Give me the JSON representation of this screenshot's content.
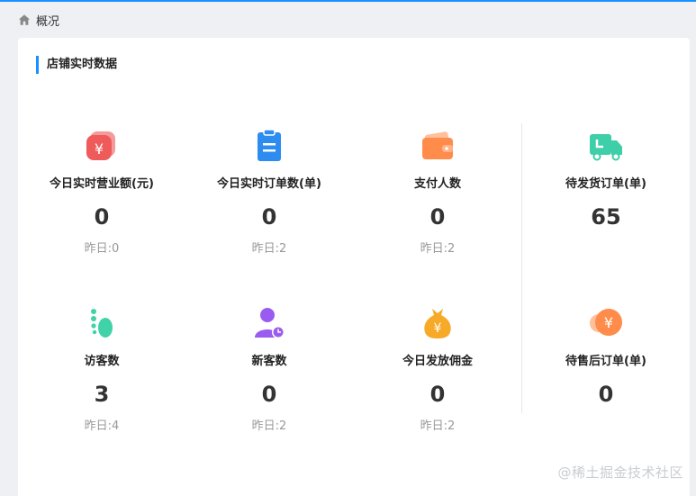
{
  "breadcrumb": {
    "label": "概况"
  },
  "section": {
    "title": "店铺实时数据"
  },
  "stats_row1": [
    {
      "label": "今日实时营业额(元)",
      "value": "0",
      "sub": "昨日:0",
      "icon": "money-card-icon",
      "color": "#ef5a5a"
    },
    {
      "label": "今日实时订单数(单)",
      "value": "0",
      "sub": "昨日:2",
      "icon": "clipboard-icon",
      "color": "#2d8cf0"
    },
    {
      "label": "支付人数",
      "value": "0",
      "sub": "昨日:2",
      "icon": "wallet-icon",
      "color": "#ff8c4a"
    },
    {
      "label": "待发货订单(单)",
      "value": "65",
      "sub": "",
      "icon": "truck-icon",
      "color": "#3ecfa8"
    }
  ],
  "stats_row2": [
    {
      "label": "访客数",
      "value": "3",
      "sub": "昨日:4",
      "icon": "footprint-icon",
      "color": "#40d2a8"
    },
    {
      "label": "新客数",
      "value": "0",
      "sub": "昨日:2",
      "icon": "new-user-icon",
      "color": "#9a5cf0"
    },
    {
      "label": "今日发放佣金",
      "value": "0",
      "sub": "昨日:2",
      "icon": "money-bag-icon",
      "color": "#f7a928"
    },
    {
      "label": "待售后订单(单)",
      "value": "0",
      "sub": "",
      "icon": "refund-coin-icon",
      "color": "#ff8c4a"
    }
  ],
  "watermark": "@稀土掘金技术社区"
}
